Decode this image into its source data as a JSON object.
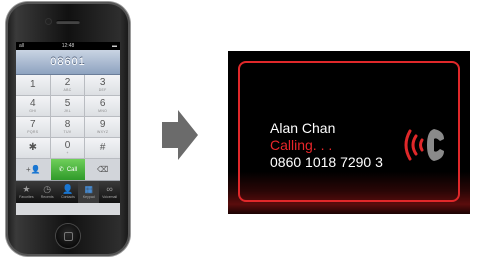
{
  "phone": {
    "status_left": "all",
    "status_mid": "12:48",
    "status_right": "▬",
    "dialed_number": "08601",
    "keys": [
      {
        "num": "1",
        "sub": ""
      },
      {
        "num": "2",
        "sub": "ABC"
      },
      {
        "num": "3",
        "sub": "DEF"
      },
      {
        "num": "4",
        "sub": "GHI"
      },
      {
        "num": "5",
        "sub": "JKL"
      },
      {
        "num": "6",
        "sub": "MNO"
      },
      {
        "num": "7",
        "sub": "PQRS"
      },
      {
        "num": "8",
        "sub": "TUV"
      },
      {
        "num": "9",
        "sub": "WXYZ"
      },
      {
        "num": "✱",
        "sub": ""
      },
      {
        "num": "0",
        "sub": "+"
      },
      {
        "num": "#",
        "sub": ""
      }
    ],
    "add_contact": "+👤",
    "call_label": "Call",
    "call_icon": "✆",
    "delete_icon": "⌫",
    "tabs": [
      {
        "icon": "★",
        "label": "Favorites"
      },
      {
        "icon": "◷",
        "label": "Recents"
      },
      {
        "icon": "👤",
        "label": "Contacts"
      },
      {
        "icon": "▦",
        "label": "Keypad"
      },
      {
        "icon": "∞",
        "label": "Voicemail"
      }
    ]
  },
  "car_display": {
    "caller_name": "Alan Chan",
    "call_status": "Calling. . .",
    "phone_number": "0860 1018 7290 3"
  },
  "colors": {
    "accent_red": "#e0282a",
    "call_green": "#3fae35",
    "arrow_gray": "#6b6b6b"
  }
}
